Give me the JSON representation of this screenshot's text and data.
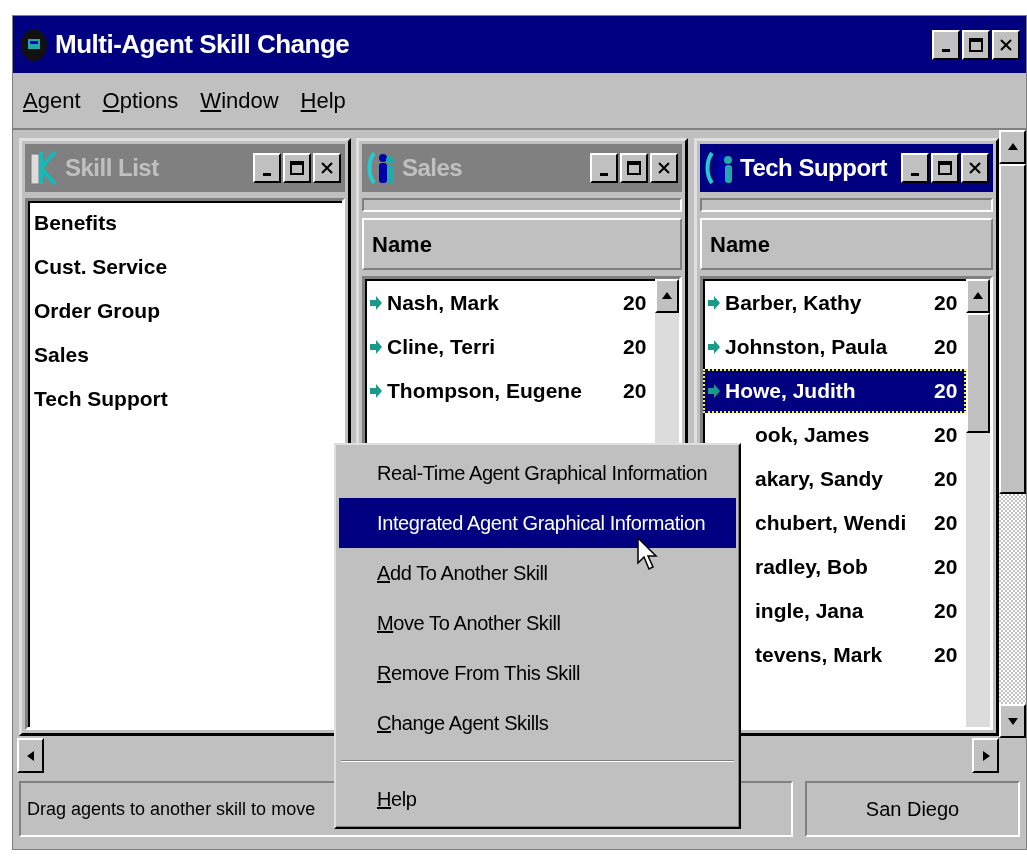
{
  "window": {
    "title": "Multi-Agent Skill Change"
  },
  "menu_bar": [
    {
      "label": "Agent",
      "mnemonic": true
    },
    {
      "label": "Options",
      "mnemonic": true
    },
    {
      "label": "Window",
      "mnemonic": true
    },
    {
      "label": "Help",
      "mnemonic": true
    }
  ],
  "child_windows": [
    {
      "kind": "listbox",
      "title": "Skill List",
      "active": false,
      "items": [
        {
          "label": "Benefits",
          "selected": false
        },
        {
          "label": "Cust. Service",
          "selected": false
        },
        {
          "label": "Order Group",
          "selected": false
        },
        {
          "label": "Sales",
          "selected": false
        },
        {
          "label": "Tech Support",
          "selected": false
        }
      ]
    },
    {
      "kind": "agent_list",
      "title": "Sales",
      "active": false,
      "column": "Name",
      "rows": [
        {
          "kind": "full",
          "name": "Nash, Mark",
          "number": "20",
          "selected": false
        },
        {
          "kind": "full",
          "name": "Cline, Terri",
          "number": "20",
          "selected": false
        },
        {
          "kind": "full",
          "name": "Thompson, Eugene",
          "number": "20",
          "selected": false
        }
      ]
    },
    {
      "kind": "agent_list",
      "title": "Tech Support",
      "active": true,
      "column": "Name",
      "rows": [
        {
          "kind": "full",
          "name": "Barber, Kathy",
          "number": "20",
          "selected": false
        },
        {
          "kind": "full",
          "name": "Johnston, Paula",
          "number": "20",
          "selected": false
        },
        {
          "kind": "full",
          "name": "Howe, Judith",
          "number": "20",
          "selected": true
        },
        {
          "kind": "partial",
          "name": "ook, James",
          "number": "20",
          "selected": false
        },
        {
          "kind": "partial",
          "name": "akary, Sandy",
          "number": "20",
          "selected": false
        },
        {
          "kind": "partial",
          "name": "chubert, Wendi",
          "number": "20",
          "selected": false
        },
        {
          "kind": "partial",
          "name": "radley, Bob",
          "number": "20",
          "selected": false
        },
        {
          "kind": "partial",
          "name": "ingle, Jana",
          "number": "20",
          "selected": false
        },
        {
          "kind": "partial",
          "name": "tevens, Mark",
          "number": "20",
          "selected": false
        }
      ]
    }
  ],
  "context_menu": [
    {
      "kind": "item",
      "label": "Real-Time Agent Graphical Information",
      "mnemonic": false,
      "selected": false
    },
    {
      "kind": "item",
      "label": "Integrated Agent Graphical Information",
      "mnemonic": false,
      "selected": true
    },
    {
      "kind": "item",
      "label": "Add To Another Skill",
      "mnemonic": true,
      "selected": false
    },
    {
      "kind": "item",
      "label": "Move To Another Skill",
      "mnemonic": true,
      "selected": false
    },
    {
      "kind": "item",
      "label": "Remove From This Skill",
      "mnemonic": true,
      "selected": false
    },
    {
      "kind": "item",
      "label": "Change Agent Skills",
      "mnemonic": true,
      "selected": false
    },
    {
      "kind": "separator"
    },
    {
      "kind": "item",
      "label": "Help",
      "mnemonic": true,
      "selected": false
    }
  ],
  "status_bar": {
    "message": "Drag agents to another skill to move",
    "location": "San Diego"
  }
}
